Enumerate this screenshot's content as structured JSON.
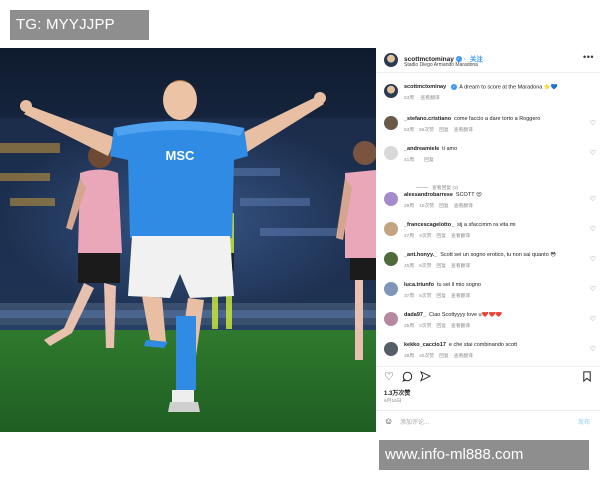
{
  "watermarks": {
    "top": "TG: MYYJJPP",
    "bottom": "www.info-ml888.com"
  },
  "post": {
    "username": "scottmctominay",
    "follow_label": "关注",
    "location": "Stadio Diego Armando Maradona",
    "more_icon": "more-horizontal-icon",
    "shirt_text": "MSC"
  },
  "caption": {
    "username": "scottmctominay",
    "text": "A dream to score at the Maradona ⭐️💙",
    "time": "63周",
    "translate": "查看翻译"
  },
  "comments": [
    {
      "username": "_stefano.cristiano",
      "text": "come faccio a dare torto a Roggero",
      "time": "53周",
      "likes": "56次赞",
      "reply": "回复",
      "translate": "查看翻译",
      "avatar_color": "#6b5a4a"
    },
    {
      "username": "_andreamiele",
      "text": "ti amo",
      "time": "41周",
      "likes": "",
      "reply": "回复",
      "translate": "",
      "avatar_color": "#d9d9d9"
    },
    {
      "username": "alessandrobarrese",
      "text": "SCOTT 😍",
      "time": "29周",
      "likes": "10次赞",
      "reply": "回复",
      "translate": "查看翻译",
      "avatar_color": "#a58bc9"
    },
    {
      "username": "_francescagelotto_",
      "text": "sij a sfaccimm ra vita mi",
      "time": "47周",
      "likes": "4次赞",
      "reply": "回复",
      "translate": "查看翻译",
      "avatar_color": "#c5a37e"
    },
    {
      "username": "_ant.honyy._",
      "text": "Scott sei un sogno erotico, tu non sai quanto 😳",
      "time": "45周",
      "likes": "6次赞",
      "reply": "回复",
      "translate": "查看翻译",
      "avatar_color": "#4f6b3b"
    },
    {
      "username": "luca.triunfo",
      "text": "tu sei il mio sogno",
      "time": "37周",
      "likes": "5次赞",
      "reply": "回复",
      "translate": "查看翻译",
      "avatar_color": "#7f96b8"
    },
    {
      "username": "dada97_",
      "text": "Ciao Scottyyyy love u❤️❤️❤️",
      "time": "25周",
      "likes": "2次赞",
      "reply": "回复",
      "translate": "查看翻译",
      "avatar_color": "#b58aa0"
    },
    {
      "username": "kekko_caccio17",
      "text": "e che stai combinando scott",
      "time": "38周",
      "likes": "40次赞",
      "reply": "回复",
      "translate": "查看翻译",
      "avatar_color": "#555d66"
    }
  ],
  "replies_label": "查看回复 (2)",
  "actions": {
    "like_icon": "heart-icon",
    "comment_icon": "comment-icon",
    "share_icon": "share-icon",
    "save_icon": "bookmark-icon"
  },
  "likes": "1.3万次赞",
  "post_date": "6月16日",
  "add_comment": {
    "placeholder": "添加评论...",
    "post_label": "发布"
  }
}
